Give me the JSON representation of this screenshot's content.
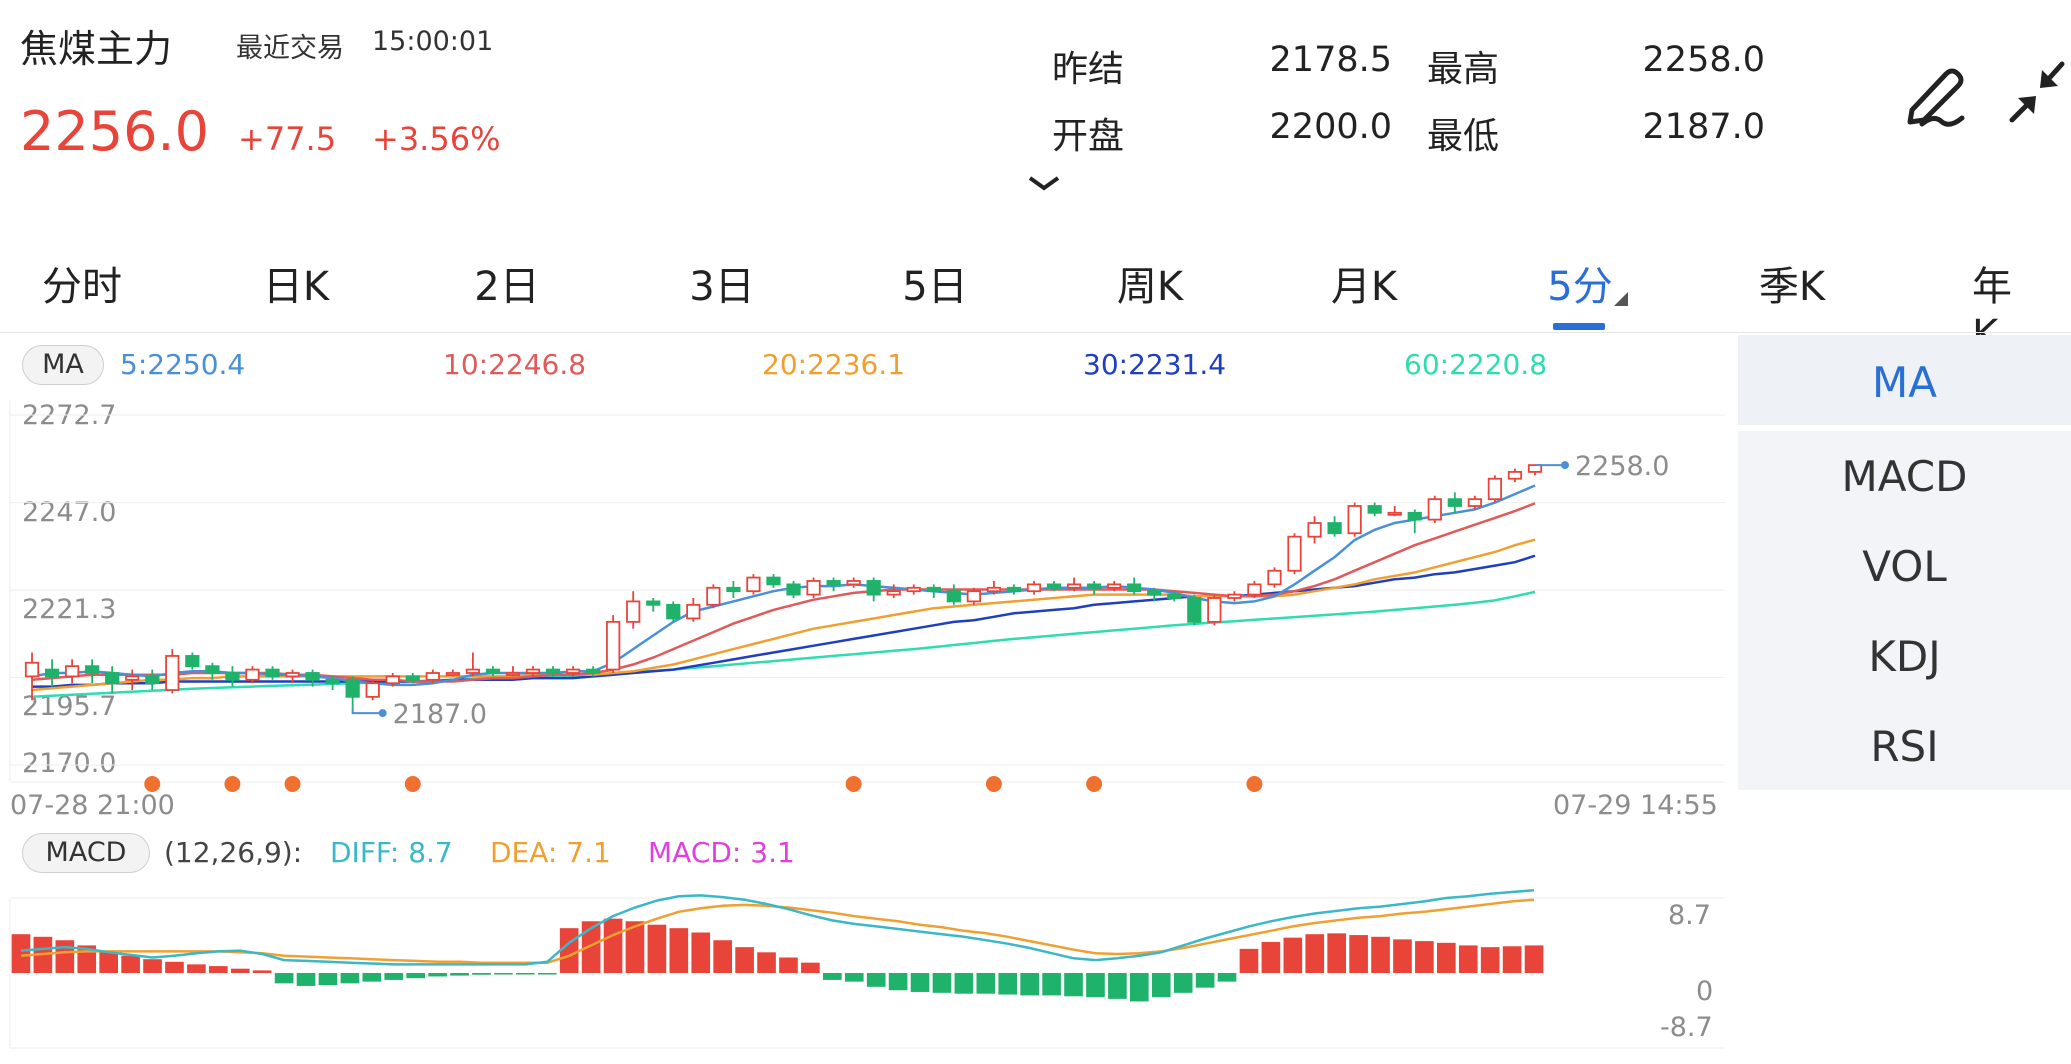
{
  "header": {
    "title": "焦煤主力",
    "last_trade_label": "最近交易",
    "last_trade_time": "15:00:01",
    "price": "2256.0",
    "change": "+77.5",
    "change_pct": "+3.56%",
    "stats": {
      "prev_settle_label": "昨结",
      "prev_settle": "2178.5",
      "high_label": "最高",
      "high": "2258.0",
      "open_label": "开盘",
      "open": "2200.0",
      "low_label": "最低",
      "low": "2187.0"
    }
  },
  "tabs": [
    "分时",
    "日K",
    "2日",
    "3日",
    "5日",
    "周K",
    "月K",
    "5分",
    "季K",
    "年K"
  ],
  "active_tab": "5分",
  "side_indicators": [
    "MA",
    "MACD",
    "VOL",
    "KDJ",
    "RSI"
  ],
  "active_indicator": "MA",
  "colors": {
    "up": "#e8443a",
    "down": "#1fb26a",
    "ma5": "#4a90d9",
    "ma10": "#e05a5a",
    "ma20": "#f0a030",
    "ma30": "#1f3fbf",
    "ma60": "#2fdcb0",
    "diff": "#3bb8c8",
    "dea": "#f0a030",
    "macd": "#e040e0",
    "accent": "#2a6fd6",
    "marker": "#f07030"
  },
  "icons": [
    "pen-icon",
    "collapse-icon",
    "chevron-down-icon"
  ],
  "ma_legend": {
    "pill": "MA",
    "ma5": "5:2250.4",
    "ma10": "10:2246.8",
    "ma20": "20:2236.1",
    "ma30": "30:2231.4",
    "ma60": "60:2220.8"
  },
  "macd_legend": {
    "pill": "MACD",
    "params": "(12,26,9):",
    "diff": "DIFF: 8.7",
    "dea": "DEA: 7.1",
    "macd": "MACD: 3.1"
  },
  "chart_data": [
    {
      "type": "candlestick",
      "y_ticks": [
        "2272.7",
        "2247.0",
        "2221.3",
        "2195.7",
        "2170.0"
      ],
      "ylim": [
        2170.0,
        2272.7
      ],
      "x_start_label": "07-28 21:00",
      "x_end_label": "07-29 14:55",
      "max_annotation": "2258.0",
      "min_annotation": "2187.0",
      "candles": [
        [
          2196,
          2200,
          2189,
          2203
        ],
        [
          2198,
          2196,
          2193,
          2201
        ],
        [
          2196,
          2199,
          2194,
          2201
        ],
        [
          2199,
          2197,
          2194,
          2201
        ],
        [
          2197,
          2194,
          2191,
          2199
        ],
        [
          2195,
          2196,
          2192,
          2198
        ],
        [
          2196,
          2194,
          2192,
          2198
        ],
        [
          2192,
          2202,
          2191,
          2204
        ],
        [
          2202,
          2199,
          2198,
          2203
        ],
        [
          2199,
          2197,
          2195,
          2200
        ],
        [
          2197,
          2195,
          2193,
          2199
        ],
        [
          2195,
          2198,
          2194,
          2199
        ],
        [
          2198,
          2196,
          2195,
          2199
        ],
        [
          2196,
          2197,
          2194,
          2198
        ],
        [
          2197,
          2195,
          2193,
          2198
        ],
        [
          2195,
          2194,
          2192,
          2196
        ],
        [
          2195,
          2190,
          2187,
          2196
        ],
        [
          2190,
          2194,
          2189,
          2195
        ],
        [
          2194,
          2196,
          2193,
          2197
        ],
        [
          2196,
          2195,
          2194,
          2197
        ],
        [
          2195,
          2197,
          2194,
          2198
        ],
        [
          2197,
          2197,
          2196,
          2198
        ],
        [
          2197,
          2198,
          2196,
          2203
        ],
        [
          2198,
          2197,
          2196,
          2199
        ],
        [
          2197,
          2197,
          2196,
          2199
        ],
        [
          2197,
          2198,
          2196,
          2199
        ],
        [
          2198,
          2197,
          2196,
          2199
        ],
        [
          2197,
          2198,
          2196,
          2199
        ],
        [
          2198,
          2197,
          2196,
          2199
        ],
        [
          2198,
          2212,
          2197,
          2214
        ],
        [
          2212,
          2218,
          2210,
          2221
        ],
        [
          2218,
          2217,
          2215,
          2219
        ],
        [
          2217,
          2213,
          2212,
          2218
        ],
        [
          2213,
          2217,
          2212,
          2219
        ],
        [
          2217,
          2222,
          2216,
          2223
        ],
        [
          2222,
          2221,
          2219,
          2224
        ],
        [
          2221,
          2225,
          2220,
          2226
        ],
        [
          2225,
          2223,
          2222,
          2226
        ],
        [
          2223,
          2220,
          2219,
          2224
        ],
        [
          2220,
          2224,
          2219,
          2225
        ],
        [
          2224,
          2223,
          2221,
          2225
        ],
        [
          2223,
          2224,
          2222,
          2225
        ],
        [
          2224,
          2220,
          2218,
          2225
        ],
        [
          2220,
          2221,
          2219,
          2223
        ],
        [
          2221,
          2222,
          2220,
          2223
        ],
        [
          2222,
          2221,
          2219,
          2223
        ],
        [
          2221,
          2218,
          2217,
          2223
        ],
        [
          2218,
          2221,
          2217,
          2222
        ],
        [
          2221,
          2222,
          2220,
          2224
        ],
        [
          2222,
          2221,
          2220,
          2223
        ],
        [
          2221,
          2223,
          2220,
          2224
        ],
        [
          2223,
          2222,
          2221,
          2224
        ],
        [
          2222,
          2223,
          2221,
          2225
        ],
        [
          2223,
          2222,
          2220,
          2224
        ],
        [
          2222,
          2223,
          2221,
          2224
        ],
        [
          2223,
          2221,
          2220,
          2225
        ],
        [
          2221,
          2220,
          2218,
          2222
        ],
        [
          2220,
          2219,
          2218,
          2221
        ],
        [
          2219,
          2212,
          2211,
          2220
        ],
        [
          2212,
          2219,
          2211,
          2220
        ],
        [
          2219,
          2220,
          2218,
          2221
        ],
        [
          2220,
          2223,
          2219,
          2224
        ],
        [
          2223,
          2227,
          2222,
          2228
        ],
        [
          2227,
          2237,
          2226,
          2238
        ],
        [
          2237,
          2241,
          2235,
          2243
        ],
        [
          2241,
          2238,
          2237,
          2243
        ],
        [
          2238,
          2246,
          2237,
          2247
        ],
        [
          2246,
          2244,
          2243,
          2247
        ],
        [
          2244,
          2244,
          2243,
          2246
        ],
        [
          2244,
          2242,
          2238,
          2245
        ],
        [
          2242,
          2248,
          2241,
          2249
        ],
        [
          2248,
          2246,
          2244,
          2250
        ],
        [
          2246,
          2248,
          2245,
          2249
        ],
        [
          2248,
          2254,
          2247,
          2255
        ],
        [
          2254,
          2256,
          2253,
          2257
        ],
        [
          2256,
          2258,
          2255,
          2258
        ]
      ],
      "ma": {
        "ma5": [
          2196,
          2197,
          2197,
          2197.5,
          2197,
          2196.5,
          2196,
          2197,
          2197.5,
          2197.5,
          2197,
          2197,
          2196.5,
          2196.5,
          2196,
          2195.5,
          2194.5,
          2194,
          2193.5,
          2193.5,
          2194,
          2195,
          2196.5,
          2197,
          2197,
          2197,
          2197,
          2197.5,
          2197.5,
          2200,
          2204,
          2208,
          2212,
          2215,
          2216.5,
          2218,
          2219.5,
          2221,
          2222,
          2222.5,
          2222.5,
          2223,
          2222.5,
          2222,
          2221.5,
          2221,
          2220.5,
          2220,
          2220.5,
          2221,
          2221.5,
          2222,
          2222,
          2222,
          2222.5,
          2222,
          2221.5,
          2220.5,
          2219,
          2218,
          2217.5,
          2218,
          2219.5,
          2223,
          2227,
          2231,
          2236,
          2239,
          2241,
          2242,
          2243,
          2244,
          2245,
          2247,
          2249.5,
          2252
        ],
        "ma10": [
          2195,
          2195.5,
          2196,
          2196.5,
          2196.5,
          2196.5,
          2196.5,
          2196.5,
          2197,
          2197,
          2197,
          2197,
          2197,
          2196.5,
          2196.5,
          2196,
          2195.5,
          2195,
          2195,
          2194.5,
          2194.5,
          2194.5,
          2195,
          2195.5,
          2195.5,
          2196,
          2196.5,
          2196.5,
          2197,
          2198,
          2199.5,
          2201.5,
          2204,
          2206.5,
          2209,
          2211.5,
          2213.5,
          2215.5,
          2217,
          2218.5,
          2219.5,
          2220.5,
          2221,
          2221.5,
          2221.5,
          2221.5,
          2221.5,
          2221.5,
          2221.5,
          2221.5,
          2221.5,
          2221.5,
          2221.5,
          2221.5,
          2221.5,
          2221.5,
          2221.5,
          2221,
          2220.5,
          2220,
          2219.5,
          2219.5,
          2220,
          2221,
          2222.5,
          2224.5,
          2227,
          2229.5,
          2232,
          2234.5,
          2236.5,
          2238.5,
          2240.5,
          2242.5,
          2244.5,
          2246.8
        ],
        "ma20": [
          2192,
          2192.5,
          2193,
          2193.5,
          2194,
          2194.5,
          2195,
          2195,
          2195.5,
          2195.5,
          2196,
          2196,
          2196,
          2196,
          2196,
          2196,
          2196,
          2196,
          2196,
          2196,
          2196,
          2196,
          2196,
          2196,
          2196,
          2196.5,
          2196.5,
          2196.5,
          2196.5,
          2197,
          2197.5,
          2198.5,
          2199.5,
          2201,
          2202.5,
          2204,
          2205.5,
          2207,
          2208.5,
          2210,
          2211,
          2212,
          2213,
          2214,
          2215,
          2216,
          2216.5,
          2217,
          2217.5,
          2218,
          2218.5,
          2219,
          2219.5,
          2220,
          2220,
          2220,
          2220,
          2220,
          2219.5,
          2219.5,
          2219.5,
          2219.5,
          2219.5,
          2220,
          2221,
          2222,
          2223,
          2224.5,
          2225.5,
          2226.5,
          2228,
          2229.5,
          2231,
          2232.5,
          2234.5,
          2236.1
        ],
        "ma30": [
          2193,
          2193,
          2193.5,
          2193.5,
          2194,
          2194,
          2194,
          2194.5,
          2194.5,
          2194.5,
          2194.5,
          2194.5,
          2194.5,
          2194.5,
          2194.5,
          2194.5,
          2194.5,
          2194.5,
          2194.5,
          2194.5,
          2194.5,
          2195,
          2195,
          2195,
          2195,
          2195.5,
          2195.5,
          2195.5,
          2196,
          2196.5,
          2197,
          2197.5,
          2198,
          2199,
          2200,
          2201,
          2202,
          2203,
          2204,
          2205,
          2206,
          2207,
          2208,
          2209,
          2210,
          2211,
          2212,
          2212.5,
          2213.5,
          2214.5,
          2215,
          2215.5,
          2216,
          2217,
          2217.5,
          2218,
          2218.5,
          2219,
          2219.5,
          2219.5,
          2219.5,
          2220,
          2220.5,
          2221,
          2221.5,
          2222,
          2222.5,
          2223.5,
          2224.5,
          2225,
          2226,
          2226.5,
          2227.5,
          2228.5,
          2229.5,
          2231.4
        ],
        "ma60": [
          2190,
          2190.3,
          2190.6,
          2190.9,
          2191.2,
          2191.5,
          2191.8,
          2192.1,
          2192.4,
          2192.6,
          2192.8,
          2193,
          2193.2,
          2193.4,
          2193.6,
          2193.8,
          2194,
          2194.2,
          2194.4,
          2194.6,
          2194.8,
          2195,
          2195.2,
          2195.4,
          2195.6,
          2195.8,
          2196,
          2196.2,
          2196.4,
          2196.8,
          2197.2,
          2197.6,
          2198,
          2198.5,
          2199,
          2199.5,
          2200,
          2200.5,
          2201,
          2201.5,
          2202,
          2202.5,
          2203,
          2203.5,
          2204,
          2204.6,
          2205.2,
          2205.8,
          2206.4,
          2207,
          2207.5,
          2208,
          2208.5,
          2209,
          2209.5,
          2210,
          2210.5,
          2211,
          2211.4,
          2211.8,
          2212.2,
          2212.6,
          2213,
          2213.4,
          2213.8,
          2214.2,
          2214.6,
          2215,
          2215.5,
          2216,
          2216.5,
          2217,
          2217.6,
          2218.3,
          2219.5,
          2220.8
        ]
      },
      "marker_candle_indices": [
        6,
        10,
        13,
        19,
        41,
        48,
        53,
        61
      ]
    },
    {
      "type": "macd",
      "y_ticks": [
        "8.7",
        "0",
        "-8.7"
      ],
      "ylim": [
        -8.7,
        8.7
      ],
      "histogram": [
        4.5,
        4.2,
        3.8,
        3.2,
        2.6,
        2.0,
        1.6,
        1.3,
        1.0,
        0.8,
        0.5,
        0.3,
        -1.2,
        -1.5,
        -1.4,
        -1.2,
        -1.0,
        -0.8,
        -0.6,
        -0.4,
        -0.3,
        -0.2,
        -0.1,
        -0.1,
        -0.1,
        5.2,
        6.0,
        6.3,
        6.0,
        5.6,
        5.2,
        4.7,
        3.8,
        3.0,
        2.4,
        1.8,
        1.2,
        -0.8,
        -1.0,
        -1.6,
        -2.0,
        -2.2,
        -2.3,
        -2.4,
        -2.4,
        -2.5,
        -2.6,
        -2.6,
        -2.7,
        -2.8,
        -3.0,
        -3.3,
        -2.8,
        -2.3,
        -1.7,
        -1.0,
        2.8,
        3.6,
        4.1,
        4.5,
        4.6,
        4.4,
        4.2,
        3.9,
        3.7,
        3.5,
        3.2,
        3.0,
        3.1,
        3.2
      ],
      "diff": [
        2.6,
        2.8,
        3.0,
        2.8,
        2.4,
        2.1,
        1.8,
        2.0,
        2.3,
        2.5,
        2.6,
        2.2,
        1.5,
        1.4,
        1.3,
        1.2,
        1.1,
        1.0,
        1.0,
        1.0,
        1.0,
        1.0,
        1.0,
        1.0,
        1.3,
        3.5,
        5.2,
        6.6,
        7.6,
        8.4,
        8.9,
        9.0,
        8.8,
        8.5,
        8.0,
        7.4,
        6.7,
        6.1,
        5.7,
        5.4,
        5.1,
        4.8,
        4.5,
        4.2,
        3.8,
        3.4,
        2.9,
        2.3,
        1.7,
        1.5,
        1.7,
        2.0,
        2.4,
        3.2,
        4.0,
        4.7,
        5.4,
        6.0,
        6.5,
        6.9,
        7.2,
        7.5,
        7.7,
        8.0,
        8.3,
        8.7,
        8.9,
        9.2,
        9.4,
        9.6
      ],
      "dea": [
        2.0,
        2.2,
        2.4,
        2.5,
        2.5,
        2.5,
        2.5,
        2.5,
        2.5,
        2.5,
        2.4,
        2.3,
        2.0,
        1.9,
        1.8,
        1.7,
        1.6,
        1.5,
        1.4,
        1.3,
        1.3,
        1.2,
        1.2,
        1.2,
        1.2,
        2.0,
        3.2,
        4.4,
        5.4,
        6.3,
        7.1,
        7.5,
        7.8,
        7.9,
        7.8,
        7.6,
        7.3,
        7.0,
        6.6,
        6.3,
        6.0,
        5.6,
        5.3,
        4.9,
        4.6,
        4.2,
        3.7,
        3.2,
        2.7,
        2.3,
        2.2,
        2.3,
        2.5,
        2.9,
        3.4,
        3.9,
        4.4,
        4.9,
        5.4,
        5.8,
        6.1,
        6.4,
        6.6,
        6.9,
        7.1,
        7.4,
        7.7,
        8.0,
        8.3,
        8.5
      ]
    }
  ]
}
